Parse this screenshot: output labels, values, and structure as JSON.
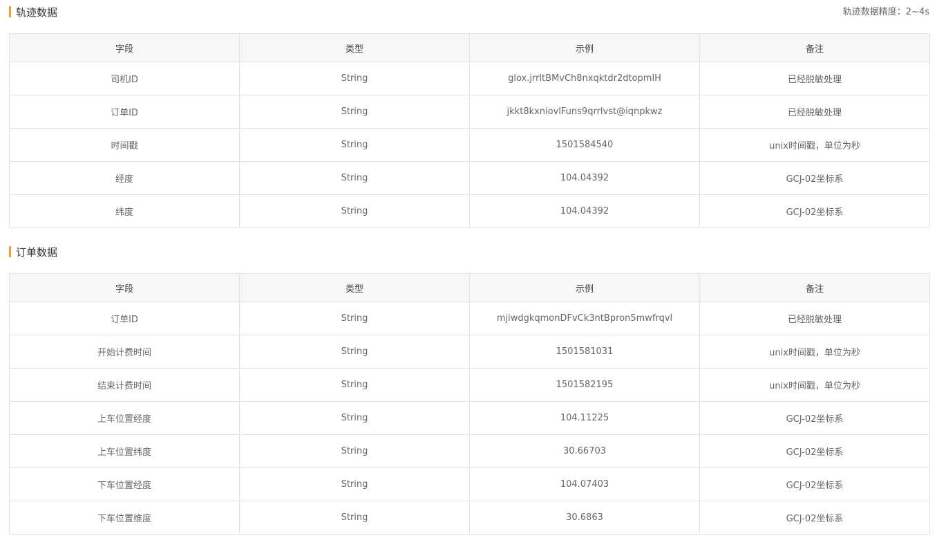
{
  "track_section": {
    "title": "轨迹数据",
    "precision_note": "轨迹数据精度：2~4s",
    "columns": [
      "字段",
      "类型",
      "示例",
      "备注"
    ],
    "rows": [
      [
        "司机ID",
        "String",
        "glox.jrrltBMvCh8nxqktdr2dtopmlH",
        "已经脱敏处理"
      ],
      [
        "订单ID",
        "String",
        "jkkt8kxniovlFuns9qrrlvst@iqnpkwz",
        "已经脱敏处理"
      ],
      [
        "时间戳",
        "String",
        "1501584540",
        "unix时间戳，单位为秒"
      ],
      [
        "经度",
        "String",
        "104.04392",
        "GCJ-02坐标系"
      ],
      [
        "纬度",
        "String",
        "104.04392",
        "GCJ-02坐标系"
      ]
    ]
  },
  "order_section": {
    "title": "订单数据",
    "columns": [
      "字段",
      "类型",
      "示例",
      "备注"
    ],
    "rows": [
      [
        "订单ID",
        "String",
        "mjiwdgkqmonDFvCk3ntBpron5mwfrqvl",
        "已经脱敏处理"
      ],
      [
        "开始计费时间",
        "String",
        "1501581031",
        "unix时间戳，单位为秒"
      ],
      [
        "结束计费时间",
        "String",
        "1501582195",
        "unix时间戳，单位为秒"
      ],
      [
        "上车位置经度",
        "String",
        "104.11225",
        "GCJ-02坐标系"
      ],
      [
        "上车位置纬度",
        "String",
        "30.66703",
        "GCJ-02坐标系"
      ],
      [
        "下车位置经度",
        "String",
        "104.07403",
        "GCJ-02坐标系"
      ],
      [
        "下车位置维度",
        "String",
        "30.6863",
        "GCJ-02坐标系"
      ]
    ]
  },
  "colors": {
    "accent": "#f39c3d",
    "header_bg": "#f7f7f7",
    "border": "#e3e3e3"
  }
}
